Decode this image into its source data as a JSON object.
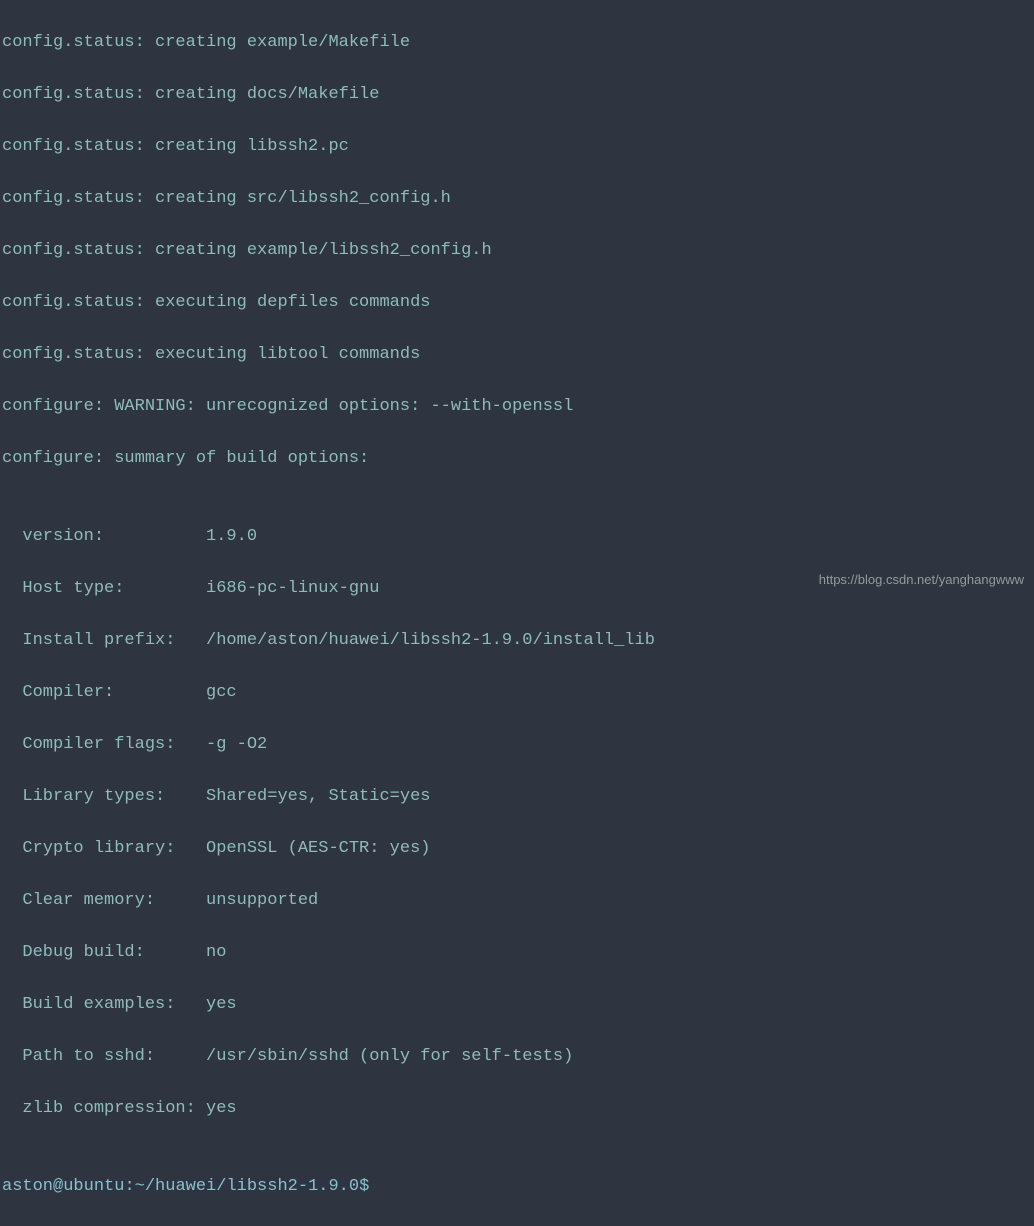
{
  "lines": [
    "config.status: creating example/Makefile",
    "config.status: creating docs/Makefile",
    "config.status: creating libssh2.pc",
    "config.status: creating src/libssh2_config.h",
    "config.status: creating example/libssh2_config.h",
    "config.status: executing depfiles commands",
    "config.status: executing libtool commands",
    "configure: WARNING: unrecognized options: --with-openssl",
    "configure: summary of build options:",
    "",
    "  version:          1.9.0",
    "  Host type:        i686-pc-linux-gnu",
    "  Install prefix:   /home/aston/huawei/libssh2-1.9.0/install_lib",
    "  Compiler:         gcc",
    "  Compiler flags:   -g -O2",
    "  Library types:    Shared=yes, Static=yes",
    "  Crypto library:   OpenSSL (AES-CTR: yes)",
    "  Clear memory:     unsupported",
    "  Debug build:      no",
    "  Build examples:   yes",
    "  Path to sshd:     /usr/sbin/sshd (only for self-tests)",
    "  zlib compression: yes",
    ""
  ],
  "prompt": {
    "user": "aston",
    "host": "ubuntu",
    "path": "~/huawei/libssh2-1.9.0",
    "separator_at": "@",
    "separator_colon": ":",
    "dollar": "$"
  },
  "watermark": "https://blog.csdn.net/yanghangwww"
}
